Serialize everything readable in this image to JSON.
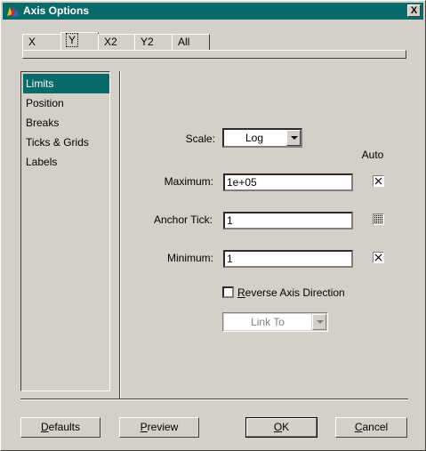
{
  "window": {
    "title": "Axis Options",
    "close": "X"
  },
  "tabs": [
    {
      "label": "X"
    },
    {
      "label": "Y"
    },
    {
      "label": "X2"
    },
    {
      "label": "Y2"
    },
    {
      "label": "All"
    }
  ],
  "categories": [
    {
      "label": "Limits"
    },
    {
      "label": "Position"
    },
    {
      "label": "Breaks"
    },
    {
      "label": "Ticks & Grids"
    },
    {
      "label": "Labels"
    }
  ],
  "form": {
    "scale_label": "Scale:",
    "scale_value": "Log",
    "auto_header": "Auto",
    "maximum_label": "Maximum:",
    "maximum_value": "1e+05",
    "anchor_label": "Anchor Tick:",
    "anchor_value": "1",
    "minimum_label": "Minimum:",
    "minimum_value": "1",
    "reverse_label_first": "R",
    "reverse_label_rest": "everse Axis Direction",
    "linkto_value": "Link To"
  },
  "buttons": {
    "defaults_first": "D",
    "defaults_rest": "efaults",
    "preview_first": "P",
    "preview_rest": "review",
    "ok_first": "O",
    "ok_rest": "K",
    "cancel_first": "C",
    "cancel_rest": "ancel"
  },
  "colors": {
    "accent": "#0a6a6a",
    "face": "#d4d0c8"
  }
}
